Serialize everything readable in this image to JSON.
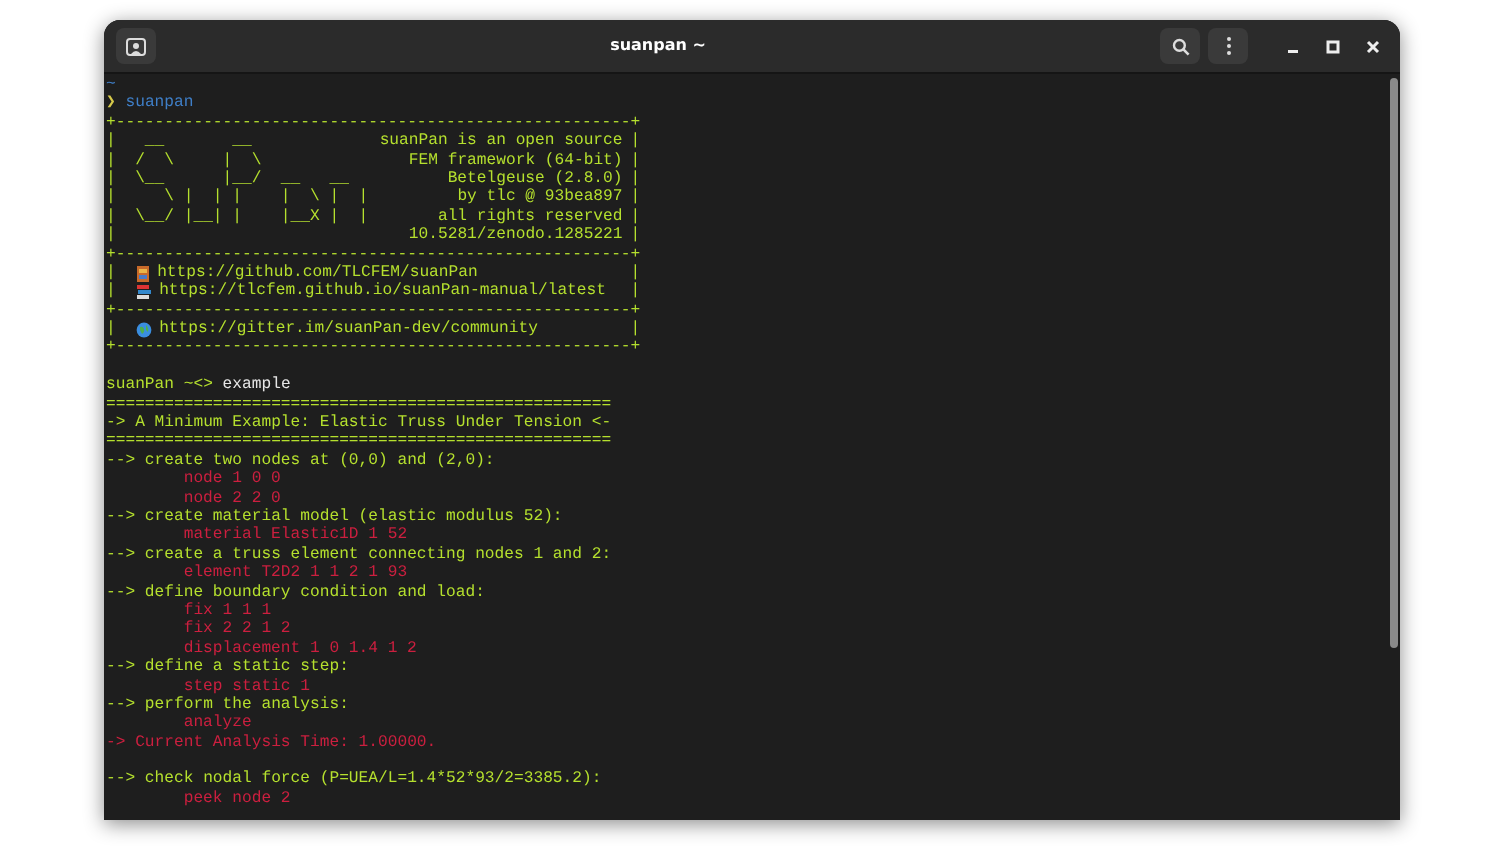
{
  "window": {
    "title": "suanpan ~"
  },
  "terminal": {
    "lines": [
      {
        "kind": "path",
        "text": "~"
      },
      {
        "kind": "prompt",
        "symbol": "❯",
        "text": "suanpan"
      },
      {
        "kind": "border",
        "text": "+-----------------------------------------------------+"
      },
      {
        "kind": "box",
        "left": "|",
        "art": "   __       __",
        "info": "suanPan is an open source",
        "right": "|"
      },
      {
        "kind": "box",
        "left": "|",
        "art": "  /  \\     |  \\",
        "info": "FEM framework (64-bit)",
        "right": "|"
      },
      {
        "kind": "box",
        "left": "|",
        "art": "  \\__      |__/  __   __",
        "info": "Betelgeuse (2.8.0)",
        "right": "|"
      },
      {
        "kind": "box",
        "left": "|",
        "art": "     \\ |  | |    |  \\ |  |",
        "info": "by tlc @ 93bea897",
        "right": "|"
      },
      {
        "kind": "box",
        "left": "|",
        "art": "  \\__/ |__| |    |__X |  |",
        "info": "all rights reserved",
        "right": "|"
      },
      {
        "kind": "box",
        "left": "|",
        "info": "10.5281/zenodo.1285221",
        "right": "|"
      },
      {
        "kind": "border",
        "text": "+-----------------------------------------------------+"
      },
      {
        "kind": "link",
        "left": "|",
        "text": "https://github.com/TLCFEM/suanPan",
        "right": "|"
      },
      {
        "kind": "link",
        "left": "|",
        "text": "https://tlcfem.github.io/suanPan-manual/latest",
        "right": "|"
      },
      {
        "kind": "border",
        "text": "+-----------------------------------------------------+"
      },
      {
        "kind": "link",
        "left": "|",
        "text": "https://gitter.im/suanPan-dev/community",
        "right": "|"
      },
      {
        "kind": "border",
        "text": "+-----------------------------------------------------+"
      },
      {
        "kind": "blank"
      },
      {
        "kind": "input",
        "prompt": "suanPan ~<>",
        "text": "example"
      },
      {
        "kind": "info",
        "text": "===================================================="
      },
      {
        "kind": "info",
        "text": "-> A Minimum Example: Elastic Truss Under Tension <-"
      },
      {
        "kind": "info",
        "text": "===================================================="
      },
      {
        "kind": "info",
        "text": "--> create two nodes at (0,0) and (2,0):"
      },
      {
        "kind": "command",
        "text": "node 1 0 0"
      },
      {
        "kind": "command",
        "text": "node 2 2 0"
      },
      {
        "kind": "info",
        "text": "--> create material model (elastic modulus 52):"
      },
      {
        "kind": "command",
        "text": "material Elastic1D 1 52"
      },
      {
        "kind": "info",
        "text": "--> create a truss element connecting nodes 1 and 2:"
      },
      {
        "kind": "command",
        "text": "element T2D2 1 1 2 1 93"
      },
      {
        "kind": "info",
        "text": "--> define boundary condition and load:"
      },
      {
        "kind": "command",
        "text": "fix 1 1 1"
      },
      {
        "kind": "command",
        "text": "fix 2 2 1 2"
      },
      {
        "kind": "command",
        "text": "displacement 1 0 1.4 1 2"
      },
      {
        "kind": "info",
        "text": "--> define a static step:"
      },
      {
        "kind": "command",
        "text": "step static 1"
      },
      {
        "kind": "info",
        "text": "--> perform the analysis:"
      },
      {
        "kind": "command",
        "text": "analyze"
      },
      {
        "kind": "error",
        "text": "-> Current Analysis Time: 1.00000."
      },
      {
        "kind": "blank"
      },
      {
        "kind": "info",
        "text": "--> check nodal force (P=UEA/L=1.4*52*93/2=3385.2):"
      },
      {
        "kind": "command",
        "text": "peek node 2"
      }
    ]
  }
}
